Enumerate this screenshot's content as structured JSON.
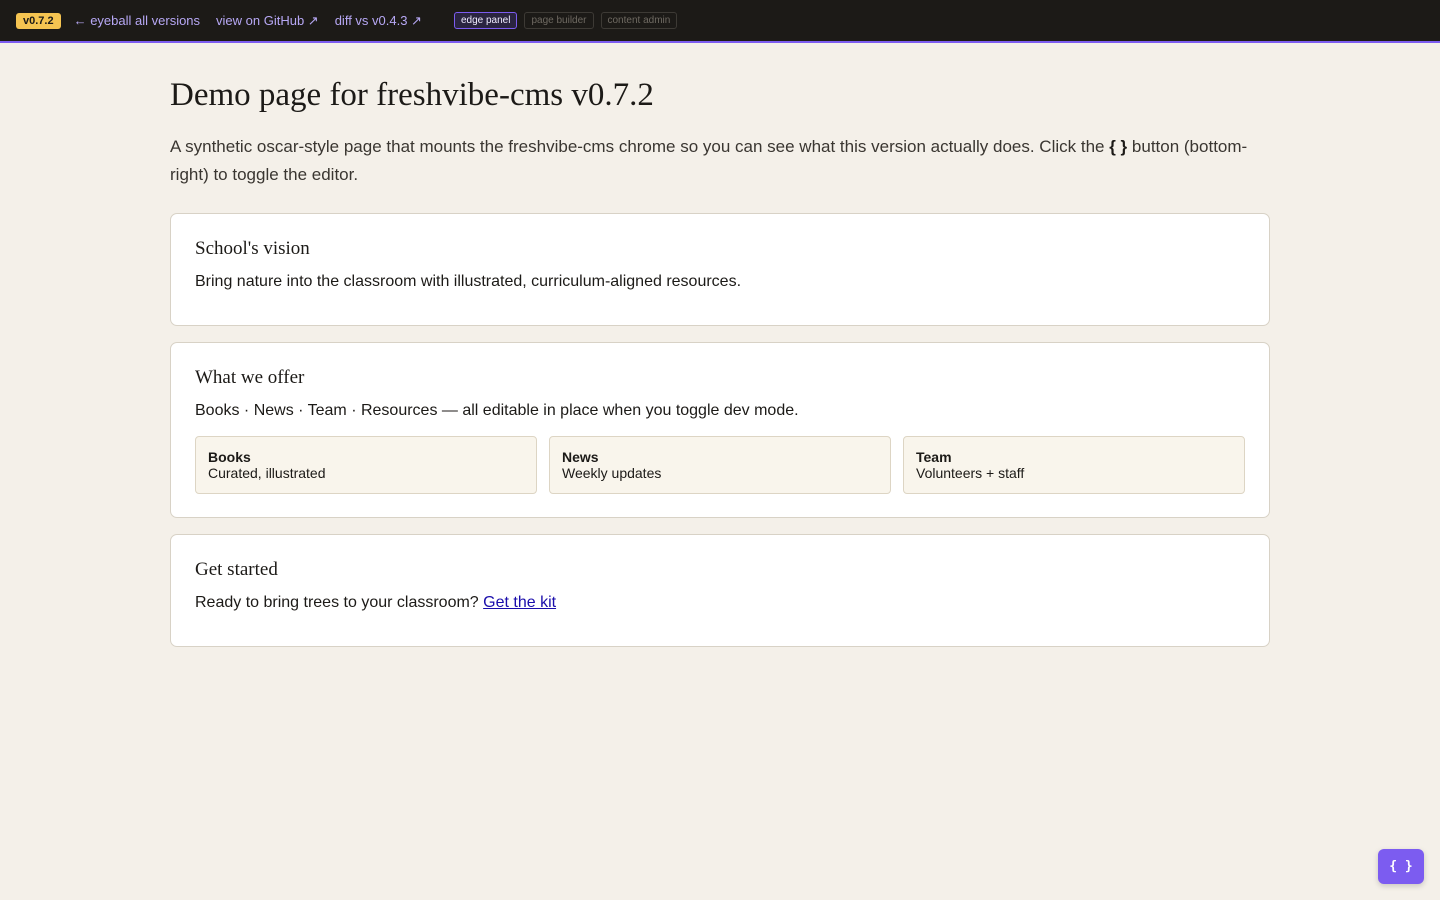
{
  "topbar": {
    "version": "v0.7.2",
    "links": [
      {
        "label": "← eyeball all versions"
      },
      {
        "label": "view on GitHub ↗"
      },
      {
        "label": "diff vs v0.4.3 ↗"
      }
    ],
    "modes": [
      {
        "label": "edge panel",
        "active": true
      },
      {
        "label": "page builder",
        "active": false
      },
      {
        "label": "content admin",
        "active": false
      }
    ]
  },
  "page": {
    "title": "Demo page for freshvibe-cms v0.7.2",
    "intro_before": "A synthetic oscar-style page that mounts the freshvibe-cms chrome so you can see what this version actually does. Click the ",
    "intro_code": "{ }",
    "intro_after": " button (bottom-right) to toggle the editor."
  },
  "sections": {
    "vision": {
      "title": "School's vision",
      "body": "Bring nature into the classroom with illustrated, curriculum-aligned resources."
    },
    "offer": {
      "title": "What we offer",
      "body": "Books · News · Team · Resources — all editable in place when you toggle dev mode.",
      "items": [
        {
          "title": "Books",
          "subtitle": "Curated, illustrated"
        },
        {
          "title": "News",
          "subtitle": "Weekly updates"
        },
        {
          "title": "Team",
          "subtitle": "Volunteers + staff"
        }
      ]
    },
    "start": {
      "title": "Get started",
      "body": "Ready to bring trees to your classroom? ",
      "link_label": "Get the kit"
    }
  },
  "editor_toggle": {
    "label": "{ }"
  },
  "colors": {
    "topbar_bg": "#1c1a17",
    "accent": "#7c5cf0",
    "badge": "#f5c451",
    "page_bg": "#f4f0e9",
    "link": "#1a0dab"
  }
}
